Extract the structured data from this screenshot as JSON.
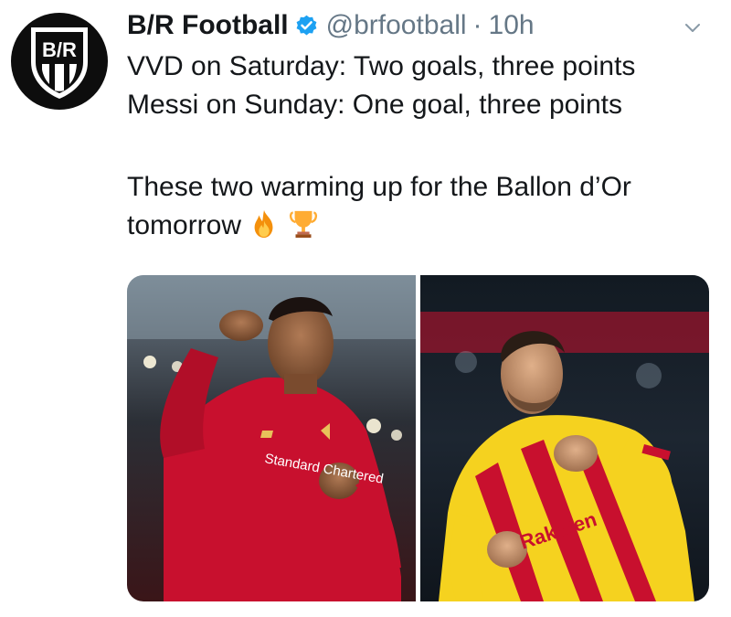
{
  "tweet": {
    "account": {
      "display_name": "B/R Football",
      "handle": "@brfootball",
      "separator": "·",
      "timestamp": "10h",
      "avatar_text": "B/R",
      "verified_icon": "verified-badge-icon"
    },
    "text_lines": [
      "VVD on Saturday: Two goals, three points",
      "Messi on Sunday: One goal, three points",
      "These two warming up for the Ballon d’Or",
      "tomorrow"
    ],
    "emojis": [
      "fire-emoji",
      "trophy-emoji"
    ],
    "media": {
      "photo_left": {
        "sponsor_text": "Standard Chartered",
        "kit_color": "#c8102e"
      },
      "photo_right": {
        "sponsor_text": "Rakuten",
        "kit_color": "#f5d21f"
      }
    }
  },
  "colors": {
    "text": "#14171a",
    "secondary_text": "#657786",
    "verified_blue": "#1da1f2",
    "avatar_bg": "#0d0d0d"
  }
}
